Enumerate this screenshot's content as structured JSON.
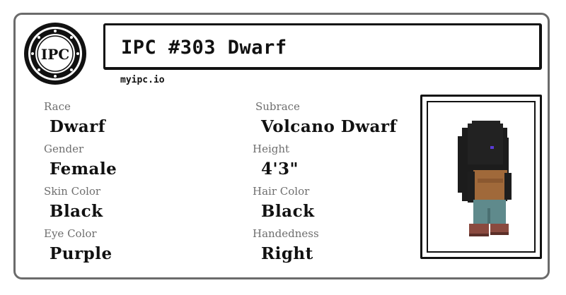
{
  "title": "IPC #303 Dwarf",
  "logo_text": "IPC",
  "site": "myipc.io",
  "attributes": [
    {
      "label": "Race",
      "value": "Dwarf"
    },
    {
      "label": "Subrace",
      "value": "Volcano Dwarf"
    },
    {
      "label": "Gender",
      "value": "Female"
    },
    {
      "label": "Height",
      "value": "4'3\""
    },
    {
      "label": "Skin Color",
      "value": "Black"
    },
    {
      "label": "Hair Color",
      "value": "Black"
    },
    {
      "label": "Eye Color",
      "value": "Purple"
    },
    {
      "label": "Handedness",
      "value": "Right"
    }
  ],
  "colors": {
    "card_border": "#6b6b6b",
    "label": "#6e6e6e",
    "text": "#111111",
    "eye": "#5a3ad6",
    "shirt": "#a0693a",
    "pants": "#5f8a8c",
    "boots": "#8a4a3f"
  }
}
